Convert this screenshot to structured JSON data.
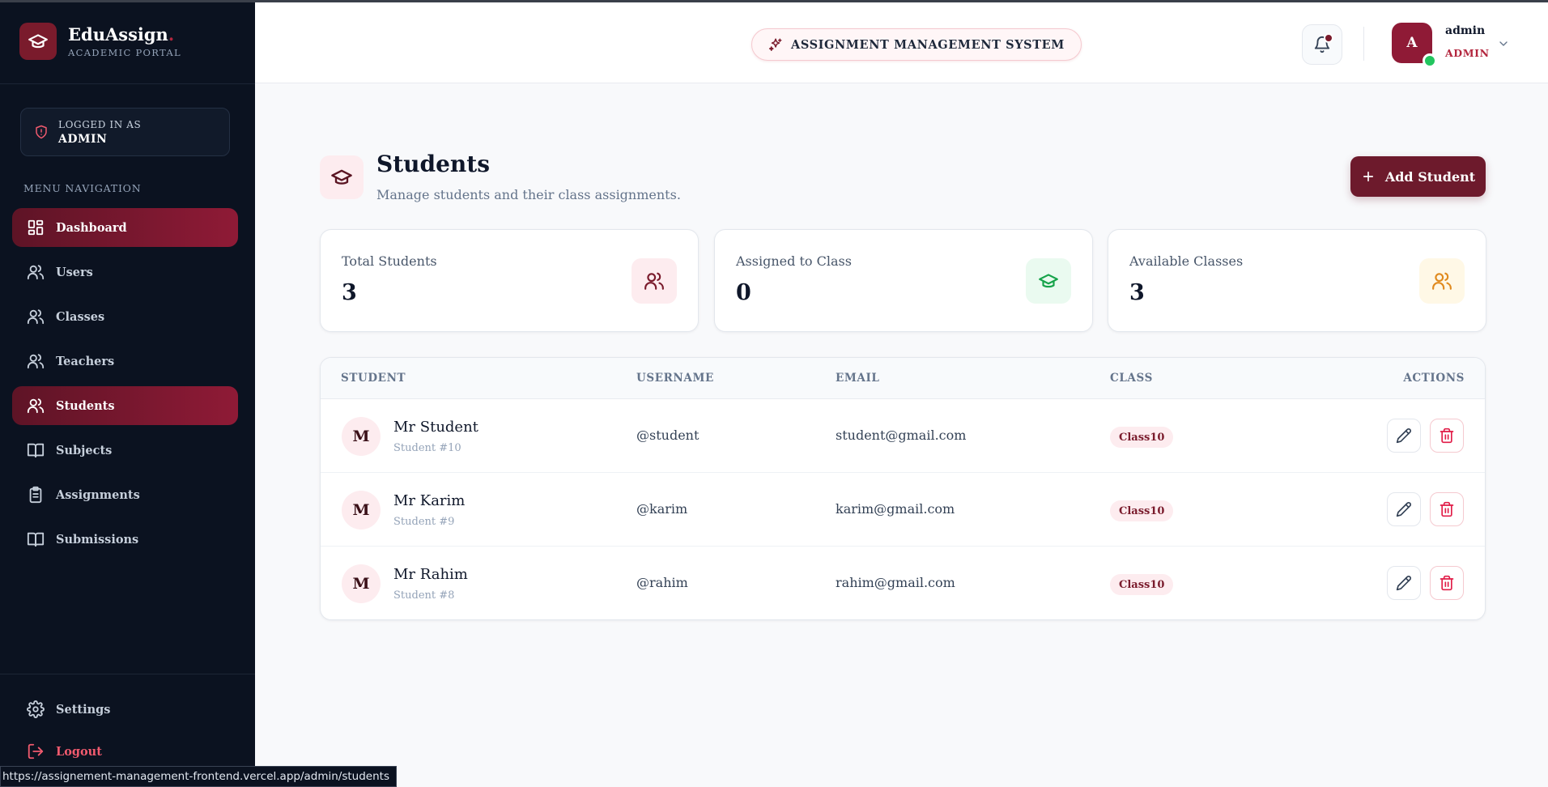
{
  "brand": {
    "name": "EduAssign",
    "dot": ".",
    "subtitle": "ACADEMIC PORTAL"
  },
  "session": {
    "label": "LOGGED IN AS",
    "role": "ADMIN"
  },
  "menu": {
    "heading": "MENU NAVIGATION",
    "items": [
      {
        "label": "Dashboard",
        "icon": "dashboard-icon",
        "active": true
      },
      {
        "label": "Users",
        "icon": "users-icon",
        "active": false
      },
      {
        "label": "Classes",
        "icon": "users-icon",
        "active": false
      },
      {
        "label": "Teachers",
        "icon": "users-icon",
        "active": false
      },
      {
        "label": "Students",
        "icon": "users-icon",
        "active": true
      },
      {
        "label": "Subjects",
        "icon": "book-icon",
        "active": false
      },
      {
        "label": "Assignments",
        "icon": "clipboard-icon",
        "active": false
      },
      {
        "label": "Submissions",
        "icon": "book-icon",
        "active": false
      }
    ],
    "settings": "Settings",
    "logout": "Logout"
  },
  "header": {
    "system_title": "ASSIGNMENT MANAGEMENT SYSTEM",
    "user": {
      "initial": "A",
      "name": "admin",
      "role": "ADMIN"
    }
  },
  "page": {
    "title": "Students",
    "subtitle": "Manage students and their class assignments.",
    "add_button": "Add Student"
  },
  "stats": [
    {
      "label": "Total Students",
      "value": "3",
      "icon": "users-icon",
      "color": "#7a1b2c",
      "bg": "#fdecef"
    },
    {
      "label": "Assigned to Class",
      "value": "0",
      "icon": "graduation-cap-icon",
      "color": "#16a34a",
      "bg": "#eafaf0"
    },
    {
      "label": "Available Classes",
      "value": "3",
      "icon": "users-icon",
      "color": "#e08a1e",
      "bg": "#fff8e6"
    }
  ],
  "table": {
    "columns": [
      "STUDENT",
      "USERNAME",
      "EMAIL",
      "CLASS",
      "ACTIONS"
    ],
    "rows": [
      {
        "initial": "M",
        "name": "Mr Student",
        "id": "Student #10",
        "username": "@student",
        "email": "student@gmail.com",
        "class": "Class10"
      },
      {
        "initial": "M",
        "name": "Mr Karim",
        "id": "Student #9",
        "username": "@karim",
        "email": "karim@gmail.com",
        "class": "Class10"
      },
      {
        "initial": "M",
        "name": "Mr Rahim",
        "id": "Student #8",
        "username": "@rahim",
        "email": "rahim@gmail.com",
        "class": "Class10"
      }
    ]
  },
  "status_url": "https://assignement-management-frontend.vercel.app/admin/students",
  "colors": {
    "accent": "#7a1b2c",
    "sidebar_bg": "#0b1220",
    "danger": "#e11d48"
  }
}
